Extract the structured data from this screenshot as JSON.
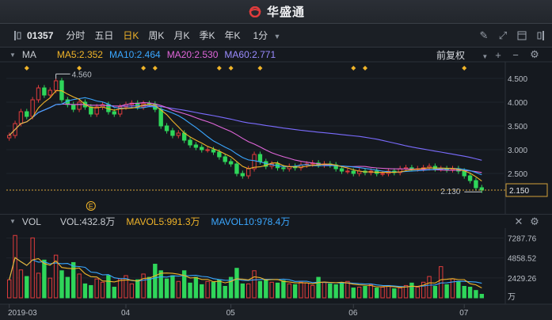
{
  "app": {
    "brand": "华盛通"
  },
  "toolbar": {
    "code": "01357",
    "periods": [
      "分时",
      "五日",
      "日K",
      "周K",
      "月K",
      "季K",
      "年K",
      "1分"
    ],
    "active_period": "日K"
  },
  "ma_bar": {
    "title": "MA",
    "ma5": "MA5:2.352",
    "ma10": "MA10:2.464",
    "ma20": "MA20:2.530",
    "ma60": "MA60:2.771",
    "adjust": "前复权"
  },
  "vol_bar": {
    "title": "VOL",
    "vol": "VOL:432.8万",
    "mavol5": "MAVOL5:991.3万",
    "mavol10": "MAVOL10:978.4万"
  },
  "colors": {
    "up": "#e03c3c",
    "down": "#2fd65a",
    "ma5": "#f0b429",
    "ma10": "#3aa7ff",
    "ma20": "#e066d9",
    "ma60": "#7b6cff"
  },
  "chart_data": {
    "type": "candlestick",
    "price_axis_ticks": [
      "4.500",
      "4.000",
      "3.500",
      "3.000",
      "2.500"
    ],
    "ylim": [
      1.85,
      4.75
    ],
    "vol_axis_ticks": [
      "7287.76",
      "4858.52",
      "2429.26"
    ],
    "vol_unit": "万",
    "vol_ylim": [
      0,
      8300
    ],
    "x_tick_labels": [
      "2019-03",
      "04",
      "05",
      "06",
      "07"
    ],
    "x_tick_index": [
      0,
      20,
      38,
      59,
      78
    ],
    "high_label": "4.560",
    "low_label": "2.130",
    "last_price": "2.150",
    "event_marker": "E",
    "event_index": 14,
    "close": [
      3.3,
      3.55,
      3.8,
      3.7,
      4.05,
      4.3,
      4.15,
      4.25,
      4.45,
      4.05,
      3.95,
      3.85,
      4.0,
      3.9,
      3.75,
      3.9,
      3.95,
      3.8,
      3.75,
      3.9,
      3.95,
      3.98,
      3.9,
      3.97,
      3.96,
      3.85,
      3.5,
      3.4,
      3.3,
      3.35,
      3.2,
      3.1,
      3.05,
      3.0,
      3.0,
      2.95,
      2.85,
      2.75,
      2.7,
      2.5,
      2.45,
      2.6,
      2.9,
      2.75,
      2.65,
      2.7,
      2.62,
      2.6,
      2.65,
      2.62,
      2.68,
      2.7,
      2.72,
      2.68,
      2.7,
      2.68,
      2.6,
      2.55,
      2.55,
      2.5,
      2.55,
      2.52,
      2.55,
      2.5,
      2.5,
      2.55,
      2.52,
      2.6,
      2.62,
      2.6,
      2.6,
      2.62,
      2.65,
      2.6,
      2.6,
      2.58,
      2.6,
      2.55,
      2.45,
      2.35,
      2.2,
      2.15
    ],
    "volume": [
      2200,
      7600,
      3400,
      2600,
      7300,
      3000,
      4600,
      2400,
      5200,
      3300,
      2500,
      4300,
      2900,
      1700,
      1500,
      2300,
      1900,
      2700,
      1300,
      2300,
      2700,
      1700,
      2200,
      2900,
      2500,
      4100,
      3300,
      2300,
      2700,
      2000,
      3300,
      1800,
      2500,
      1600,
      2000,
      1900,
      2200,
      1400,
      2500,
      3600,
      1700,
      1700,
      3300,
      2000,
      2200,
      1900,
      1800,
      2100,
      1700,
      1600,
      1900,
      1800,
      1500,
      2500,
      1900,
      1700,
      1600,
      1800,
      2000,
      1200,
      1300,
      1400,
      1600,
      1200,
      1300,
      1500,
      1100,
      1200,
      1500,
      1800,
      1300,
      1900,
      2600,
      1400,
      3800,
      1600,
      2300,
      2000,
      1400,
      1300,
      900,
      430
    ]
  }
}
